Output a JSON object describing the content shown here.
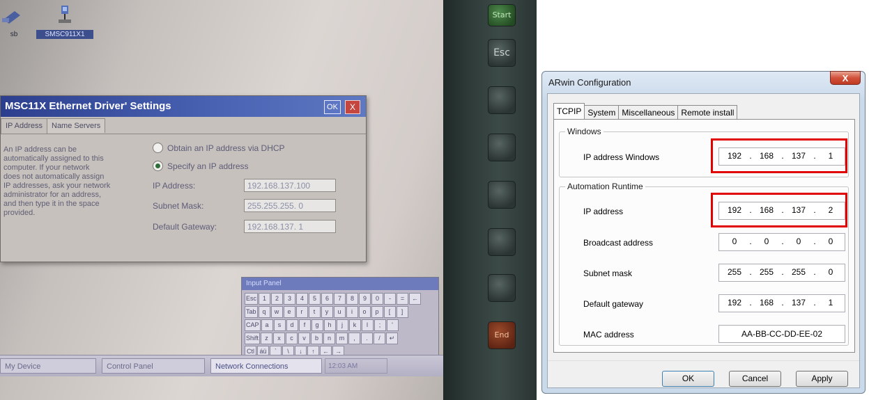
{
  "left_photo": {
    "desktop_icons": [
      {
        "label": "sb",
        "icon": "usb-icon"
      },
      {
        "label": "SMSC911X1",
        "icon": "network-adapter-icon"
      }
    ],
    "dialog": {
      "title": "MSC11X Ethernet Driver' Settings",
      "ok_label": "OK",
      "close_label": "X",
      "tabs": [
        "IP Address",
        "Name Servers"
      ],
      "help_text": "An IP address can be\nautomatically assigned to this\ncomputer.  If your network\ndoes not automatically assign\nIP addresses, ask your network\nadministrator for an address,\nand then type it in the space\nprovided.",
      "radio_dhcp": "Obtain an IP address via DHCP",
      "radio_specify": "Specify an IP address",
      "fields": [
        {
          "label": "IP Address:",
          "value": "192.168.137.100"
        },
        {
          "label": "Subnet Mask:",
          "value": "255.255.255. 0"
        },
        {
          "label": "Default Gateway:",
          "value": "192.168.137. 1"
        }
      ]
    },
    "input_panel": {
      "title": "Input Panel",
      "rows": [
        [
          "Esc",
          "1",
          "2",
          "3",
          "4",
          "5",
          "6",
          "7",
          "8",
          "9",
          "0",
          "-",
          "=",
          "←"
        ],
        [
          "Tab",
          "q",
          "w",
          "e",
          "r",
          "t",
          "y",
          "u",
          "i",
          "o",
          "p",
          "[",
          "]"
        ],
        [
          "CAP",
          "a",
          "s",
          "d",
          "f",
          "g",
          "h",
          "j",
          "k",
          "l",
          ";",
          "'"
        ],
        [
          "Shift",
          "z",
          "x",
          "c",
          "v",
          "b",
          "n",
          "m",
          ",",
          ".",
          "/",
          "↵"
        ],
        [
          "Ctl",
          "áü",
          "`",
          "\\",
          "↓",
          "↑",
          "←",
          "→"
        ]
      ]
    },
    "taskbar": {
      "buttons": [
        "My Device",
        "Control Panel",
        "Network Connections"
      ],
      "clock": "12:03 AM"
    },
    "hardware_keys": [
      "Start",
      "Esc",
      "End"
    ]
  },
  "arwin": {
    "title": "ARwin Configuration",
    "close_label": "X",
    "tabs": [
      "TCPIP",
      "System",
      "Miscellaneous",
      "Remote install"
    ],
    "active_tab": "TCPIP",
    "groups": {
      "windows": {
        "title": "Windows",
        "rows": [
          {
            "label": "IP address Windows",
            "octets": [
              "192",
              "168",
              "137",
              "1"
            ]
          }
        ]
      },
      "runtime": {
        "title": "Automation Runtime",
        "rows": [
          {
            "label": "IP address",
            "octets": [
              "192",
              "168",
              "137",
              "2"
            ]
          },
          {
            "label": "Broadcast address",
            "octets": [
              "0",
              "0",
              "0",
              "0"
            ]
          },
          {
            "label": "Subnet mask",
            "octets": [
              "255",
              "255",
              "255",
              "0"
            ]
          },
          {
            "label": "Default gateway",
            "octets": [
              "192",
              "168",
              "137",
              "1"
            ]
          }
        ],
        "mac_label": "MAC address",
        "mac_value": "AA-BB-CC-DD-EE-02"
      }
    },
    "buttons": {
      "ok": "OK",
      "cancel": "Cancel",
      "apply": "Apply"
    },
    "highlight_color": "#e00000"
  }
}
